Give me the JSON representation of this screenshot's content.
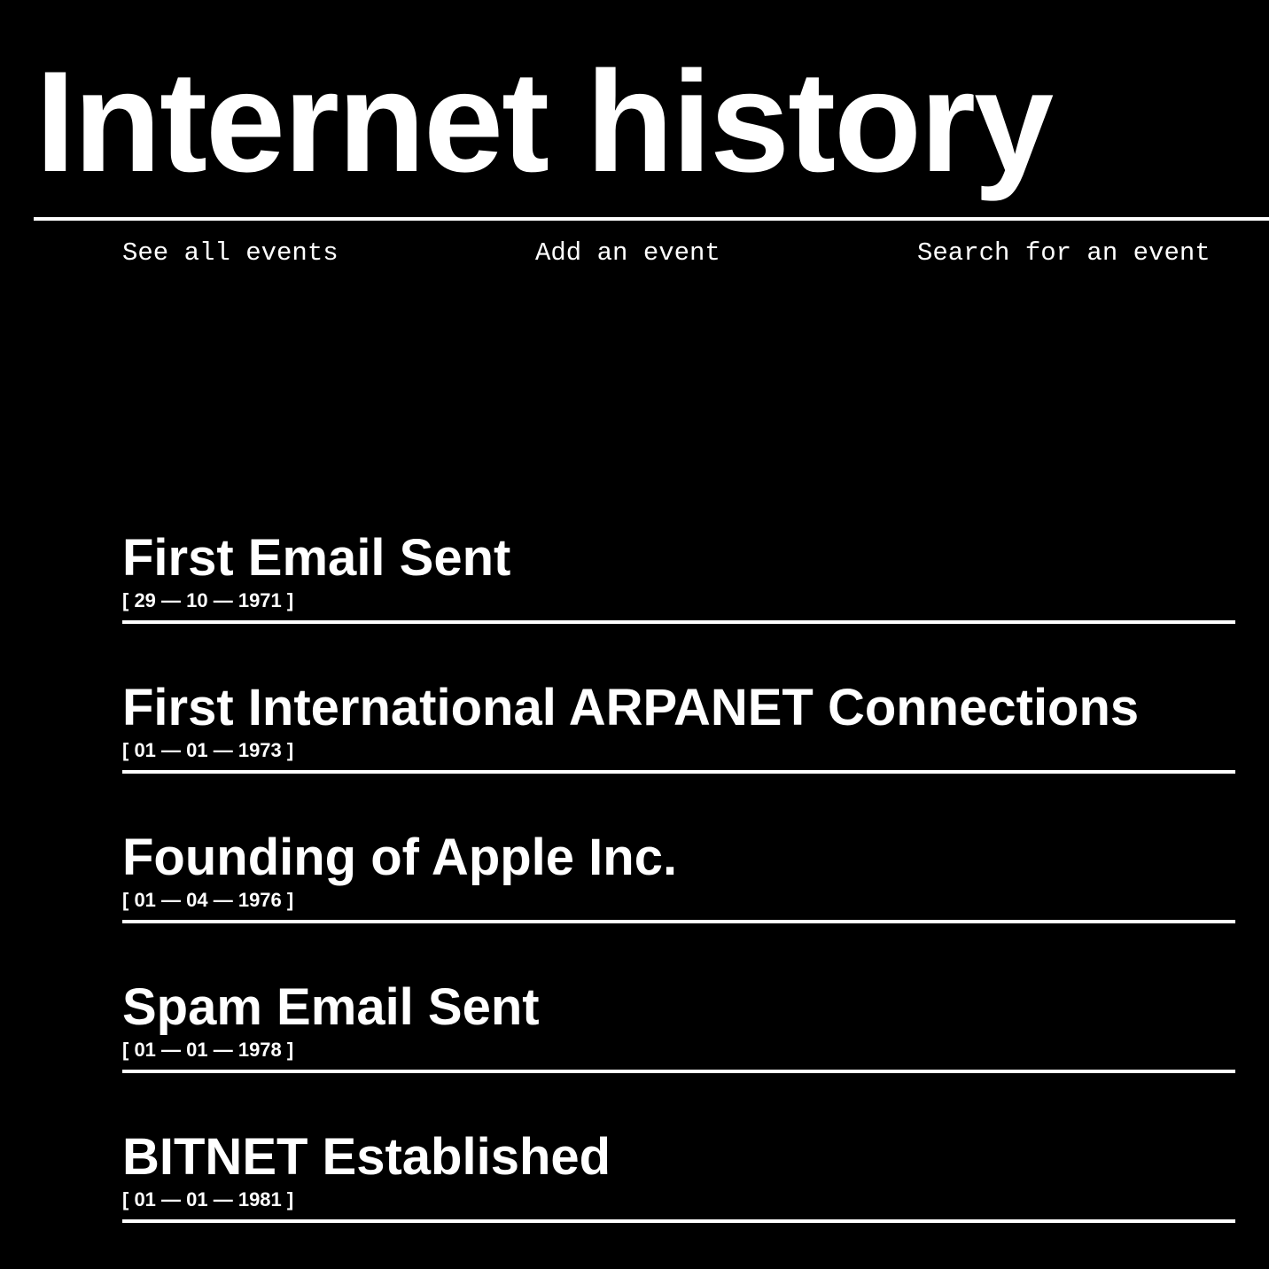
{
  "header": {
    "title": "Internet history"
  },
  "nav": {
    "items": [
      {
        "label": "See all events"
      },
      {
        "label": "Add an event"
      },
      {
        "label": "Search for an event"
      }
    ]
  },
  "events": [
    {
      "title": "First Email Sent",
      "date": "[ 29 — 10 — 1971 ]"
    },
    {
      "title": "First International ARPANET Connections",
      "date": "[ 01 — 01 — 1973 ]"
    },
    {
      "title": "Founding of Apple Inc.",
      "date": "[ 01 — 04 — 1976 ]"
    },
    {
      "title": "Spam Email Sent",
      "date": "[ 01 — 01 — 1978 ]"
    },
    {
      "title": "BITNET Established",
      "date": "[ 01 — 01 — 1981 ]"
    }
  ],
  "colors": {
    "background": "#000000",
    "foreground": "#ffffff"
  }
}
